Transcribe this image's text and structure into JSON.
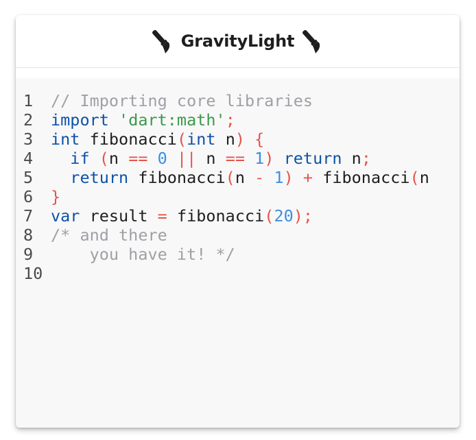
{
  "header": {
    "title": "GravityLight",
    "left_icon": "paintbrush-icon",
    "right_icon": "paintbrush-icon"
  },
  "colors": {
    "comment": "#9ea0a6",
    "keyword": "#0d52a8",
    "string": "#3a9a4a",
    "punctuation": "#e5534b",
    "number": "#3b8fe0",
    "plain": "#1f1f1f",
    "editor_background": "#f8f8f8"
  },
  "code": {
    "lines": [
      {
        "number": "1",
        "tokens": [
          {
            "t": "// Importing core libraries",
            "k": "comment"
          }
        ]
      },
      {
        "number": "2",
        "tokens": [
          {
            "t": "import",
            "k": "keyword"
          },
          {
            "t": " ",
            "k": "plain"
          },
          {
            "t": "'dart:math'",
            "k": "string"
          },
          {
            "t": ";",
            "k": "punct"
          }
        ]
      },
      {
        "number": "3",
        "tokens": [
          {
            "t": "int",
            "k": "keyword"
          },
          {
            "t": " fibonacci",
            "k": "plain"
          },
          {
            "t": "(",
            "k": "punct"
          },
          {
            "t": "int",
            "k": "keyword"
          },
          {
            "t": " n",
            "k": "plain"
          },
          {
            "t": ")",
            "k": "punct"
          },
          {
            "t": " ",
            "k": "plain"
          },
          {
            "t": "{",
            "k": "punct"
          }
        ]
      },
      {
        "number": "4",
        "tokens": [
          {
            "t": "  ",
            "k": "plain"
          },
          {
            "t": "if",
            "k": "keyword"
          },
          {
            "t": " ",
            "k": "plain"
          },
          {
            "t": "(",
            "k": "punct"
          },
          {
            "t": "n ",
            "k": "plain"
          },
          {
            "t": "==",
            "k": "punct"
          },
          {
            "t": " ",
            "k": "plain"
          },
          {
            "t": "0",
            "k": "number"
          },
          {
            "t": " ",
            "k": "plain"
          },
          {
            "t": "||",
            "k": "punct"
          },
          {
            "t": " n ",
            "k": "plain"
          },
          {
            "t": "==",
            "k": "punct"
          },
          {
            "t": " ",
            "k": "plain"
          },
          {
            "t": "1",
            "k": "number"
          },
          {
            "t": ")",
            "k": "punct"
          },
          {
            "t": " ",
            "k": "plain"
          },
          {
            "t": "return",
            "k": "keyword"
          },
          {
            "t": " n",
            "k": "plain"
          },
          {
            "t": ";",
            "k": "punct"
          }
        ]
      },
      {
        "number": "5",
        "tokens": [
          {
            "t": "  ",
            "k": "plain"
          },
          {
            "t": "return",
            "k": "keyword"
          },
          {
            "t": " fibonacci",
            "k": "plain"
          },
          {
            "t": "(",
            "k": "punct"
          },
          {
            "t": "n ",
            "k": "plain"
          },
          {
            "t": "-",
            "k": "punct"
          },
          {
            "t": " ",
            "k": "plain"
          },
          {
            "t": "1",
            "k": "number"
          },
          {
            "t": ")",
            "k": "punct"
          },
          {
            "t": " ",
            "k": "plain"
          },
          {
            "t": "+",
            "k": "punct"
          },
          {
            "t": " fibonacci",
            "k": "plain"
          },
          {
            "t": "(",
            "k": "punct"
          },
          {
            "t": "n",
            "k": "plain"
          }
        ]
      },
      {
        "number": "6",
        "tokens": [
          {
            "t": "}",
            "k": "punct"
          }
        ]
      },
      {
        "number": "7",
        "tokens": [
          {
            "t": "var",
            "k": "keyword"
          },
          {
            "t": " result ",
            "k": "plain"
          },
          {
            "t": "=",
            "k": "punct"
          },
          {
            "t": " fibonacci",
            "k": "plain"
          },
          {
            "t": "(",
            "k": "punct"
          },
          {
            "t": "20",
            "k": "number"
          },
          {
            "t": ");",
            "k": "punct"
          }
        ]
      },
      {
        "number": "8",
        "tokens": [
          {
            "t": "/* and there",
            "k": "comment"
          }
        ]
      },
      {
        "number": "9",
        "tokens": [
          {
            "t": "    you have it! */",
            "k": "comment"
          }
        ]
      },
      {
        "number": "10",
        "tokens": []
      }
    ]
  }
}
